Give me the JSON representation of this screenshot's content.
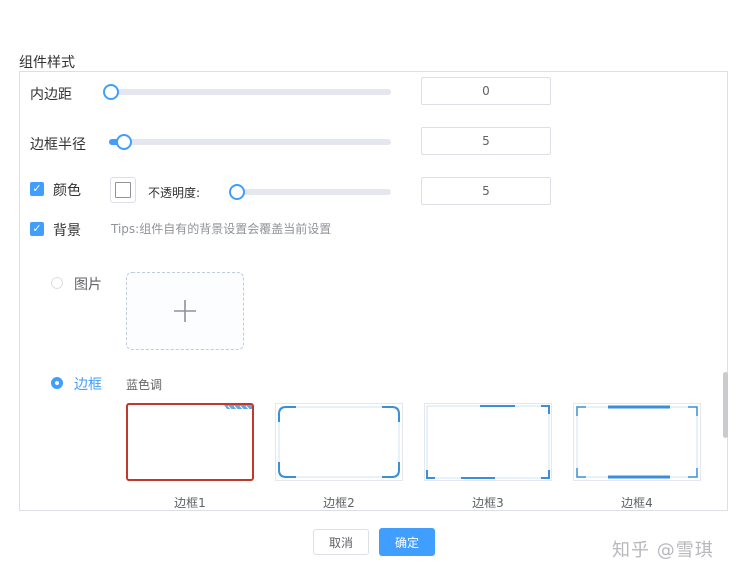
{
  "section_title": "组件样式",
  "padding": {
    "label": "内边距",
    "value": "0",
    "level": 0
  },
  "radius": {
    "label": "边框半径",
    "value": "5",
    "level": 0.05
  },
  "color": {
    "label": "颜色",
    "checked": true,
    "opacity_label": "不透明度:",
    "value": "5",
    "level": 0
  },
  "background": {
    "label": "背景",
    "checked": true,
    "tips": "Tips:组件自有的背景设置会覆盖当前设置",
    "image_option": {
      "label": "图片",
      "selected": false
    },
    "border_option": {
      "label": "边框",
      "selected": true
    },
    "border_group_label": "蓝色调",
    "borders": [
      {
        "label": "边框1",
        "selected": true
      },
      {
        "label": "边框2",
        "selected": false
      },
      {
        "label": "边框3",
        "selected": false
      },
      {
        "label": "边框4",
        "selected": false
      }
    ]
  },
  "footer": {
    "cancel_label": "取消",
    "confirm_label": "确定"
  },
  "watermark": "知乎 @雪琪",
  "colors": {
    "accent": "#409eff",
    "selected_border": "#c0392b",
    "frame_blue": "#3a8fd8"
  },
  "icons": {
    "upload": "plus-icon",
    "check": "check-icon"
  }
}
